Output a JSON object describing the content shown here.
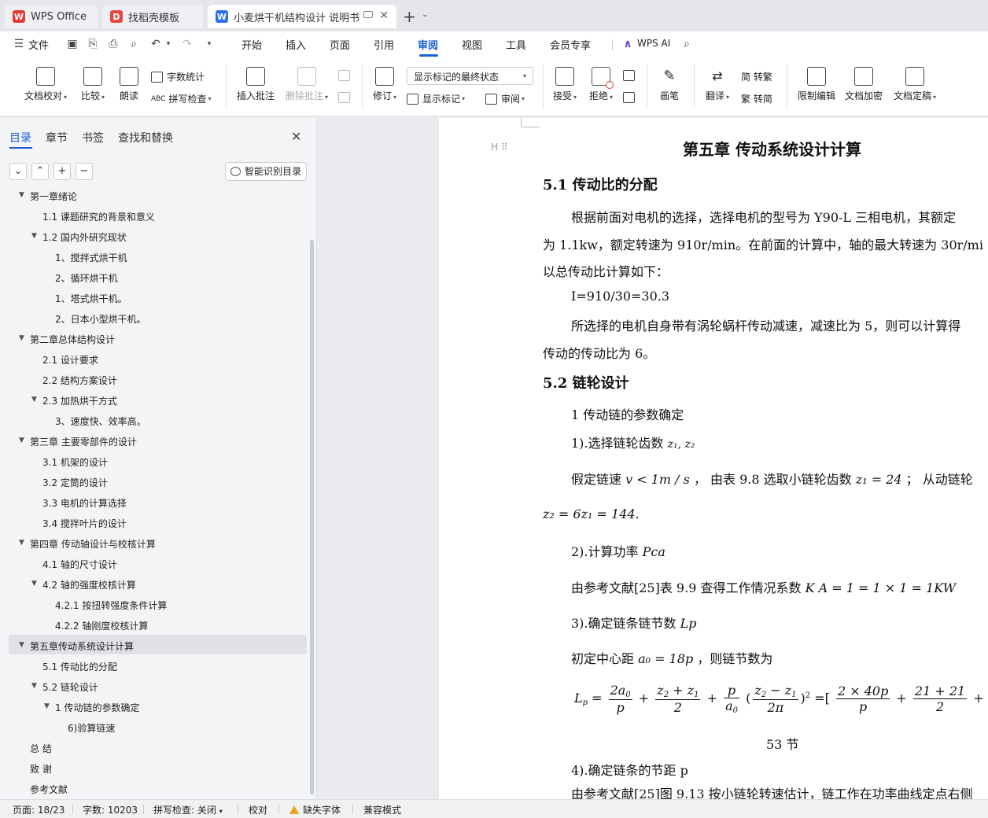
{
  "tabs": [
    {
      "label": "WPS Office",
      "icon": "wps-logo-icon"
    },
    {
      "label": "找稻壳模板",
      "icon": "docer-logo-icon"
    },
    {
      "label": "小麦烘干机结构设计 说明书（",
      "icon": "writer-doc-icon"
    }
  ],
  "menu": {
    "file": "文件",
    "items": [
      "开始",
      "插入",
      "页面",
      "引用",
      "审阅",
      "视图",
      "工具",
      "会员专享"
    ],
    "active": "审阅",
    "ai": "WPS AI"
  },
  "ribbon": {
    "doc_check": "文档校对",
    "compare": "比较",
    "read_aloud": "朗读",
    "word_count": "字数统计",
    "spell_check": "拼写检查",
    "insert_comment": "插入批注",
    "delete_comment": "删除批注",
    "track": "修订",
    "markup_state": "显示标记的最终状态",
    "show_markup": "显示标记",
    "review": "审阅",
    "accept": "接受",
    "reject": "拒绝",
    "pen": "画笔",
    "translate": "翻译",
    "to_traditional": "简 转繁",
    "to_simplified": "繁 转简",
    "restrict_edit": "限制编辑",
    "encrypt": "文档加密",
    "finalize": "文档定稿"
  },
  "sidebar": {
    "tabs": [
      "目录",
      "章节",
      "书签",
      "查找和替换"
    ],
    "smart_toc": "智能识别目录",
    "items": [
      {
        "label": "第一章绪论",
        "level": 1,
        "expanded": true
      },
      {
        "label": "1.1  课题研究的背景和意义",
        "level": 2
      },
      {
        "label": "1.2  国内外研究现状",
        "level": 2,
        "expanded": true
      },
      {
        "label": "1、搅拌式烘干机",
        "level": 3
      },
      {
        "label": "2、循环烘干机",
        "level": 3
      },
      {
        "label": "1、塔式烘干机。",
        "level": 3
      },
      {
        "label": "2、日本小型烘干机。",
        "level": 3
      },
      {
        "label": "第二章总体结构设计",
        "level": 1,
        "expanded": true
      },
      {
        "label": "2.1  设计要求",
        "level": 2
      },
      {
        "label": "2.2  结构方案设计",
        "level": 2
      },
      {
        "label": "2.3  加热烘干方式",
        "level": 2,
        "expanded": true
      },
      {
        "label": "3、速度快、效率高。",
        "level": 3
      },
      {
        "label": "第三章  主要零部件的设计",
        "level": 1,
        "expanded": true
      },
      {
        "label": "3.1  机架的设计",
        "level": 2
      },
      {
        "label": "3.2  定筒的设计",
        "level": 2
      },
      {
        "label": "3.3 电机的计算选择",
        "level": 2
      },
      {
        "label": "3.4  搅拌叶片的设计",
        "level": 2
      },
      {
        "label": "第四章  传动轴设计与校核计算",
        "level": 1,
        "expanded": true
      },
      {
        "label": "4.1  轴的尺寸设计",
        "level": 2
      },
      {
        "label": "4.2  轴的强度校核计算",
        "level": 2,
        "expanded": true
      },
      {
        "label": "4.2.1  按扭转强度条件计算",
        "level": 3
      },
      {
        "label": "4.2.2 轴刚度校核计算",
        "level": 3
      },
      {
        "label": "第五章传动系统设计计算",
        "level": 1,
        "expanded": true,
        "selected": true
      },
      {
        "label": "5.1  传动比的分配",
        "level": 2
      },
      {
        "label": "5.2  链轮设计",
        "level": 2,
        "expanded": true
      },
      {
        "label": "1 传动链的参数确定",
        "level": 3,
        "expanded": true
      },
      {
        "label": "6)验算链速",
        "level": 4
      },
      {
        "label": "总 结",
        "level": 1
      },
      {
        "label": "致 谢",
        "level": 1
      },
      {
        "label": "参考文献",
        "level": 1
      }
    ]
  },
  "document": {
    "chapter_title": "第五章  传动系统设计计算",
    "s51_title": "5.1  传动比的分配",
    "p1_l1": "根据前面对电机的选择，选择电机的型号为 Y90-L 三相电机，其额定",
    "p1_l2": "为 1.1kw，额定转速为 910r/min。在前面的计算中，轴的最大转速为 30r/mi",
    "p1_l3": "以总传动比计算如下：",
    "formula_i": "I=910/30=30.3",
    "p2_l1": "所选择的电机自身带有涡轮蜗杆传动减速，减速比为 5，则可以计算得",
    "p2_l2": "传动的传动比为 6。",
    "s52_title": "5.2  链轮设计",
    "item1": "1 传动链的参数确定",
    "step1": "1).选择链轮齿数",
    "step1_math": "z₁, z₂",
    "assume_a": "假定链速",
    "assume_math1": "v < 1m / s",
    "assume_b": "，  由表 9.8  选取小链轮齿数",
    "assume_math2": "z₁ = 24",
    "assume_c": "；  从动链轮",
    "z2_formula": "z₂ = 6z₁ = 144.",
    "step2": "2).计算功率",
    "step2_math": "Pca",
    "ka_text": "由参考文献[25]表 9.9 查得工作情况系数",
    "ka_math": "K A  = 1 = 1 × 1 = 1KW",
    "step3": "3).确定链条链节数",
    "step3_math": "Lp",
    "a0_text": "初定中心距",
    "a0_math": "a₀ = 18p",
    "a0_tail": "，则链节数为",
    "lp_result": "53 节",
    "step4": "4).确定链条的节距 p",
    "last_line": "由参考文献[25]图 9.13 按小链轮转速估计，链工作在功率曲线定点右侧"
  },
  "statusbar": {
    "page": "页面: 18/23",
    "words": "字数: 10203",
    "spell": "拼写检查: 关闭",
    "proof": "校对",
    "missing_font": "缺失字体",
    "compat": "兼容模式"
  },
  "colors": {
    "accent": "#1a5fd6",
    "wps_red": "#e03a32",
    "docer_red": "#e8483f",
    "writer_blue": "#2b6ff0"
  }
}
